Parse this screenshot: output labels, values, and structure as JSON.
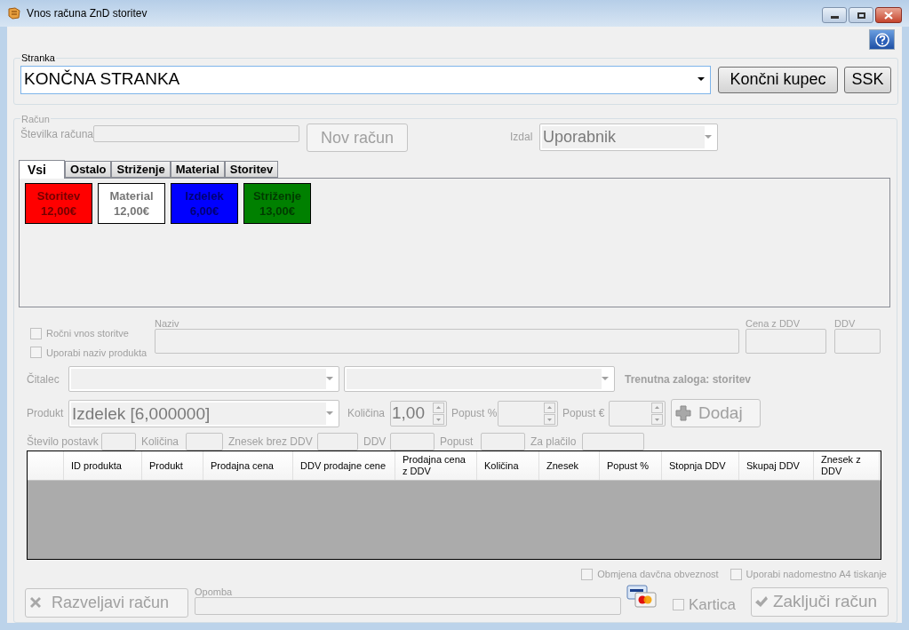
{
  "window": {
    "title": "Vnos računa ZnD storitev"
  },
  "customer": {
    "label": "Stranka",
    "value": "KONČNA STRANKA",
    "buttons": [
      {
        "label": "Končni kupec",
        "disabled": false
      },
      {
        "label": "SSK",
        "disabled": false
      }
    ]
  },
  "invoice": {
    "label": "Račun",
    "number_label": "Številka računa",
    "new_button": {
      "label": "Nov račun",
      "disabled": true
    },
    "issued_by_label": "Izdal",
    "issued_by": "Uporabnik"
  },
  "tabs": [
    {
      "label": "Vsi",
      "selected": true
    },
    {
      "label": "Ostalo",
      "selected": false
    },
    {
      "label": "Striženje",
      "selected": false
    },
    {
      "label": "Material",
      "selected": false
    },
    {
      "label": "Storitev",
      "selected": false
    }
  ],
  "products": [
    {
      "name": "Storitev",
      "price": "12,00€",
      "color": "#ff0000"
    },
    {
      "name": "Material",
      "price": "12,00€",
      "color": "#ffffff"
    },
    {
      "name": "Izdelek",
      "price": "6,00€",
      "color": "#0000ff"
    },
    {
      "name": "Striženje",
      "price": "13,00€",
      "color": "#008000"
    }
  ],
  "entry": {
    "options": [
      {
        "label": "Ročni vnos storitve",
        "checked": false
      },
      {
        "label": "Uporabi naziv produkta",
        "checked": false
      }
    ],
    "name_label": "Naziv",
    "price_label": "Cena z DDV",
    "vat_label": "DDV",
    "reader_label": "Čitalec",
    "stock": "Trenutna zaloga: storitev",
    "product_label": "Produkt",
    "product": "Izdelek [6,000000]",
    "quantity_label": "Količina",
    "quantity": "1,00",
    "discount_pct_label": "Popust %",
    "discount_eur_label": "Popust €",
    "add_button": {
      "label": "Dodaj",
      "disabled": true
    }
  },
  "summary": [
    "Število postavk",
    "Količina",
    "Znesek brez DDV",
    "DDV",
    "Popust",
    "Za plačilo"
  ],
  "table": {
    "columns": [
      "ID produkta",
      "Produkt",
      "Prodajna cena",
      "DDV prodajne cene",
      "Prodajna cena z DDV",
      "Količina",
      "Znesek",
      "Popust %",
      "Stopnja DDV",
      "Skupaj DDV",
      "Znesek z DDV"
    ]
  },
  "footer": {
    "options": [
      {
        "label": "Obmjena davčna obveznost",
        "checked": false
      },
      {
        "label": "Uporabi nadomestno A4 tiskanje",
        "checked": false
      }
    ],
    "cancel_button": {
      "label": "Razveljavi račun",
      "disabled": true
    },
    "note_label": "Opomba",
    "card": {
      "label": "Kartica",
      "checked": false
    },
    "finish_button": {
      "label": "Zaključi račun",
      "disabled": true
    }
  }
}
